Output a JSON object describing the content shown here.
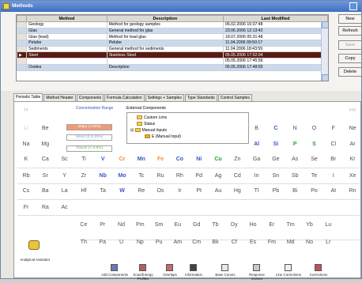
{
  "window": {
    "title": "Methods"
  },
  "grid": {
    "headers": [
      "Method",
      "Description",
      "Last Modified"
    ],
    "rows": [
      {
        "method": "Geology",
        "description": "Method for geology samples",
        "modified": "06.02.2006 16:07:48",
        "style": "plain"
      },
      {
        "method": "Glas",
        "description": "General method for glas",
        "modified": "23.06.2006 12:13:42",
        "style": "alt"
      },
      {
        "method": "Glas (lead)",
        "description": "Method for lead glas",
        "modified": "18.07.2006 05:31:48",
        "style": "plain"
      },
      {
        "method": "Pelube",
        "description": "Pelube",
        "modified": "11.04.2006 09:50:17",
        "style": "alt"
      },
      {
        "method": "Sediments",
        "description": "General method for sediments",
        "modified": "11.04.2006 18:43:59",
        "style": "plain"
      },
      {
        "method": "Steel",
        "description": "Stainless Steel",
        "modified": "05.05.2006 17:52:04",
        "style": "sel"
      },
      {
        "method": "",
        "description": "",
        "modified": "05.05.2006 17:45:56",
        "style": "plain"
      },
      {
        "method": "Oxides",
        "description": "Description",
        "modified": "05.05.2006 17:48:55",
        "style": "alt"
      }
    ]
  },
  "side_buttons": {
    "new": "New",
    "refresh": "Refresh",
    "save": "Save",
    "copy": "Copy",
    "delete": "Delete"
  },
  "tabs": [
    "Periodic Table",
    "Method Header",
    "Components",
    "Formula Calculation",
    "Settings + Samples",
    "Type Standards",
    "Control Samples"
  ],
  "concentration": {
    "label": "Concentration Range",
    "major": "Major (>10%)",
    "minor": "Minor (0.5-10%)",
    "trace": "Traces (< 0.5%)",
    "major_color": "#f29a73",
    "minor_color": "#7f9ee0",
    "trace_color": "#5aaa5a"
  },
  "external": {
    "label": "External Components",
    "items": [
      "Custom Lims",
      "Status",
      "Manual Inputs",
      "E (Manual Input)"
    ]
  },
  "elements": {
    "row1": [
      "H",
      "He"
    ],
    "row2": [
      "Li",
      "Be",
      "B",
      "C",
      "N",
      "O",
      "F",
      "Ne"
    ],
    "row3": [
      "Na",
      "Mg",
      "Al",
      "Si",
      "P",
      "S",
      "Cl",
      "Ar"
    ],
    "row4": [
      "K",
      "Ca",
      "Sc",
      "Ti",
      "V",
      "Cr",
      "Mn",
      "Fe",
      "Co",
      "Ni",
      "Cu",
      "Zn",
      "Ga",
      "Ge",
      "As",
      "Se",
      "Br",
      "Kr"
    ],
    "row5": [
      "Rb",
      "Sr",
      "Y",
      "Zr",
      "Nb",
      "Mo",
      "Tc",
      "Ru",
      "Rh",
      "Pd",
      "Ag",
      "Cd",
      "In",
      "Sn",
      "Sb",
      "Te",
      "I",
      "Xe"
    ],
    "row6": [
      "Cs",
      "Ba",
      "La",
      "Hf",
      "Ta",
      "W",
      "Re",
      "Os",
      "Ir",
      "Pt",
      "Au",
      "Hg",
      "Tl",
      "Pb",
      "Bi",
      "Po",
      "At",
      "Rn"
    ],
    "row7": [
      "Fr",
      "Ra",
      "Ac"
    ],
    "lanth": [
      "Ce",
      "Pr",
      "Nd",
      "Pm",
      "Sm",
      "Eu",
      "Gd",
      "Tb",
      "Dy",
      "Ho",
      "Er",
      "Tm",
      "Yb",
      "Lu"
    ],
    "actin": [
      "Th",
      "Pa",
      "U",
      "Np",
      "Pu",
      "Am",
      "Cm",
      "Bk",
      "Cf",
      "Es",
      "Fm",
      "Md",
      "No",
      "Lr"
    ]
  },
  "toolbar": [
    "Analytical Assistant",
    "Add Components",
    "Scan/Energy Profiles",
    "Overlaps",
    "Information",
    "Base Curves",
    "Response Curves",
    "Line Corrections",
    "Corrections"
  ]
}
